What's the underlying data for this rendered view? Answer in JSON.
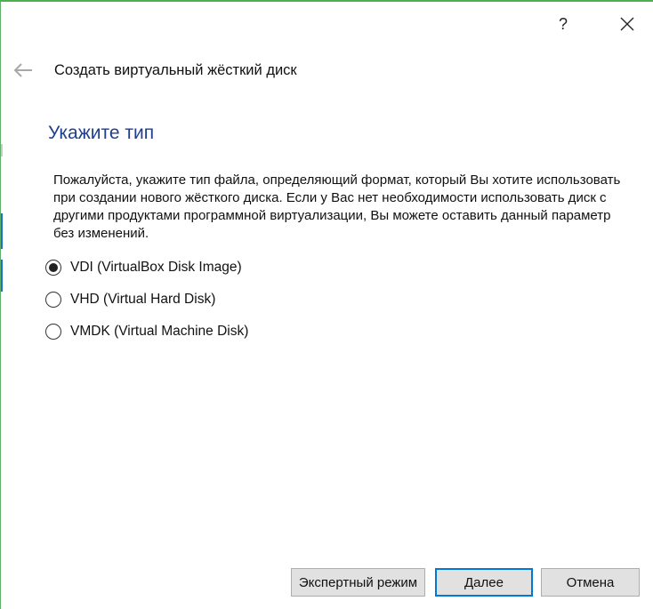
{
  "titlebar": {
    "help_label": "?",
    "close_label": "✕"
  },
  "header": {
    "back_icon": "arrow-left-icon",
    "title": "Создать виртуальный жёсткий диск"
  },
  "page": {
    "heading": "Укажите тип",
    "description": "Пожалуйста, укажите тип файла, определяющий формат, который Вы хотите использовать при создании нового жёсткого диска. Если у Вас нет необходимости использовать диск с другими продуктами программной виртуализации, Вы можете оставить данный параметр без изменений.",
    "options": [
      {
        "label": "VDI (VirtualBox Disk Image)",
        "selected": true
      },
      {
        "label": "VHD (Virtual Hard Disk)",
        "selected": false
      },
      {
        "label": "VMDK (Virtual Machine Disk)",
        "selected": false
      }
    ]
  },
  "buttons": {
    "expert": "Экспертный режим",
    "next": "Далее",
    "cancel": "Отмена"
  },
  "colors": {
    "heading": "#1f3f8f",
    "focus_border": "#0078d7",
    "window_accent": "#4caf50"
  }
}
